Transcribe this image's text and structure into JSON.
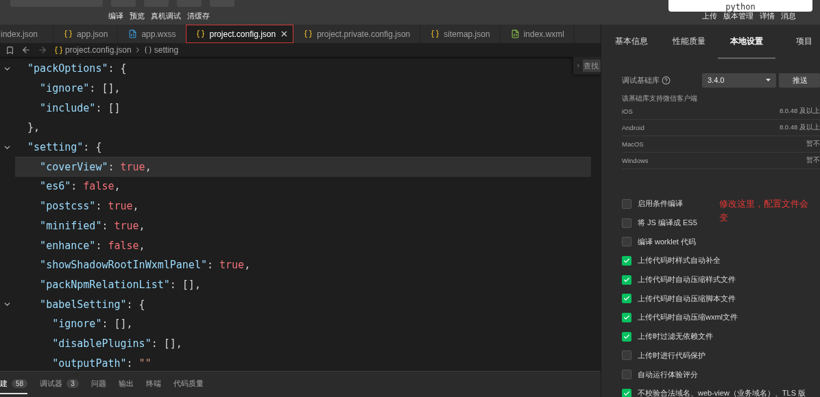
{
  "popup": {
    "text": "python"
  },
  "toolbar": {
    "left_actions": [
      "编译",
      "预览",
      "真机调试",
      "清缓存"
    ],
    "right_actions": [
      "上传",
      "版本管理",
      "详情",
      "消息"
    ]
  },
  "editor_tabs": [
    {
      "label": "index.json",
      "selected": false
    },
    {
      "label": "app.json",
      "kind": "json",
      "selected": false
    },
    {
      "label": "app.wxss",
      "kind": "css",
      "selected": false
    },
    {
      "label": "project.config.json",
      "kind": "json",
      "selected": true
    },
    {
      "label": "project.private.config.json",
      "kind": "json",
      "selected": false
    },
    {
      "label": "sitemap.json",
      "kind": "json",
      "selected": false
    },
    {
      "label": "index.wxml",
      "kind": "wxml",
      "selected": false
    }
  ],
  "breadcrumb": {
    "file": "project.config.json",
    "symbol": "setting"
  },
  "find_widget": {
    "placeholder": "查找"
  },
  "code_lines": [
    {
      "fold": true,
      "highlighted": false,
      "tokens": [
        {
          "kind": "key",
          "text": "\"packOptions\""
        },
        {
          "kind": "punct",
          "text": ": "
        },
        {
          "kind": "brace",
          "text": "{"
        }
      ],
      "children": [
        {
          "fold": false,
          "highlighted": false,
          "tokens": [
            {
              "kind": "key",
              "text": "\"ignore\""
            },
            {
              "kind": "punct",
              "text": ": [],"
            }
          ]
        },
        {
          "fold": false,
          "highlighted": false,
          "tokens": [
            {
              "kind": "key",
              "text": "\"include\""
            },
            {
              "kind": "punct",
              "text": ": []"
            }
          ]
        }
      ]
    },
    {
      "fold": false,
      "highlighted": false,
      "tokens": [
        {
          "kind": "brace",
          "text": "}"
        },
        {
          "kind": "punct",
          "text": ","
        }
      ]
    },
    {
      "fold": true,
      "highlighted": false,
      "tokens": [
        {
          "kind": "key",
          "text": "\"setting\""
        },
        {
          "kind": "punct",
          "text": ": "
        },
        {
          "kind": "brace",
          "text": "{"
        }
      ],
      "children": [
        {
          "fold": false,
          "highlighted": true,
          "tokens": [
            {
              "kind": "key",
              "text": "\"coverView\""
            },
            {
              "kind": "punct",
              "text": ": "
            },
            {
              "kind": "bool",
              "text": "true"
            },
            {
              "kind": "punct",
              "text": ","
            }
          ]
        },
        {
          "fold": false,
          "highlighted": false,
          "tokens": [
            {
              "kind": "key",
              "text": "\"es6\""
            },
            {
              "kind": "punct",
              "text": ": "
            },
            {
              "kind": "bool",
              "text": "false"
            },
            {
              "kind": "punct",
              "text": ","
            }
          ]
        },
        {
          "fold": false,
          "highlighted": false,
          "tokens": [
            {
              "kind": "key",
              "text": "\"postcss\""
            },
            {
              "kind": "punct",
              "text": ": "
            },
            {
              "kind": "bool",
              "text": "true"
            },
            {
              "kind": "punct",
              "text": ","
            }
          ]
        },
        {
          "fold": false,
          "highlighted": false,
          "tokens": [
            {
              "kind": "key",
              "text": "\"minified\""
            },
            {
              "kind": "punct",
              "text": ": "
            },
            {
              "kind": "bool",
              "text": "true"
            },
            {
              "kind": "punct",
              "text": ","
            }
          ]
        },
        {
          "fold": false,
          "highlighted": false,
          "tokens": [
            {
              "kind": "key",
              "text": "\"enhance\""
            },
            {
              "kind": "punct",
              "text": ": "
            },
            {
              "kind": "bool",
              "text": "false"
            },
            {
              "kind": "punct",
              "text": ","
            }
          ]
        },
        {
          "fold": false,
          "highlighted": false,
          "tokens": [
            {
              "kind": "key",
              "text": "\"showShadowRootInWxmlPanel\""
            },
            {
              "kind": "punct",
              "text": ": "
            },
            {
              "kind": "bool",
              "text": "true"
            },
            {
              "kind": "punct",
              "text": ","
            }
          ]
        },
        {
          "fold": false,
          "highlighted": false,
          "tokens": [
            {
              "kind": "key",
              "text": "\"packNpmRelationList\""
            },
            {
              "kind": "punct",
              "text": ": [],"
            }
          ]
        },
        {
          "fold": true,
          "highlighted": false,
          "tokens": [
            {
              "kind": "key",
              "text": "\"babelSetting\""
            },
            {
              "kind": "punct",
              "text": ": "
            },
            {
              "kind": "brace",
              "text": "{"
            }
          ],
          "children": [
            {
              "fold": false,
              "highlighted": false,
              "tokens": [
                {
                  "kind": "key",
                  "text": "\"ignore\""
                },
                {
                  "kind": "punct",
                  "text": ": [],"
                }
              ]
            },
            {
              "fold": false,
              "highlighted": false,
              "tokens": [
                {
                  "kind": "key",
                  "text": "\"disablePlugins\""
                },
                {
                  "kind": "punct",
                  "text": ": [],"
                }
              ]
            },
            {
              "fold": false,
              "highlighted": false,
              "tokens": [
                {
                  "kind": "key",
                  "text": "\"outputPath\""
                },
                {
                  "kind": "punct",
                  "text": ": "
                },
                {
                  "kind": "string",
                  "text": "\"\""
                }
              ]
            }
          ]
        }
      ]
    }
  ],
  "bottom_tabs": [
    {
      "label": "建",
      "count": "58",
      "selected": true
    },
    {
      "label": "调试器",
      "count": "3",
      "selected": false
    },
    {
      "label": "问题",
      "selected": false
    },
    {
      "label": "输出",
      "selected": false
    },
    {
      "label": "终端",
      "selected": false
    },
    {
      "label": "代码质量",
      "selected": false
    }
  ],
  "settings_panel": {
    "tabs": [
      {
        "label": "基本信息",
        "selected": false
      },
      {
        "label": "性能质量",
        "selected": false
      },
      {
        "label": "本地设置",
        "selected": true
      },
      {
        "label": "项目",
        "selected": false
      }
    ],
    "base_library": {
      "label": "调试基础库",
      "value": "3.4.0",
      "button": "推送"
    },
    "support_title": "该基础库支持微信客户端",
    "support_rows": [
      {
        "platform": "iOS",
        "version": "8.0.48 及以上"
      },
      {
        "platform": "Android",
        "version": "8.0.48 及以上"
      },
      {
        "platform": "MacOS",
        "version": "暂不"
      },
      {
        "platform": "Windows",
        "version": "暂不"
      }
    ],
    "options": [
      {
        "label": "启用条件编译",
        "checked": false
      },
      {
        "label": "将 JS 编译成 ES5",
        "checked": false
      },
      {
        "label": "编译 worklet 代码",
        "checked": false
      },
      {
        "label": "上传代码时样式自动补全",
        "checked": true
      },
      {
        "label": "上传代码时自动压缩样式文件",
        "checked": true
      },
      {
        "label": "上传代码时自动压缩脚本文件",
        "checked": true
      },
      {
        "label": "上传代码时自动压缩wxml文件",
        "checked": true
      },
      {
        "label": "上传时过滤无依赖文件",
        "checked": true
      },
      {
        "label": "上传时进行代码保护",
        "checked": false
      },
      {
        "label": "自动运行体验评分",
        "checked": false
      },
      {
        "label": "不校验合法域名、web-view（业务域名）、TLS 版",
        "checked": true
      }
    ],
    "annotation": "修改这里，配置文件会变"
  }
}
